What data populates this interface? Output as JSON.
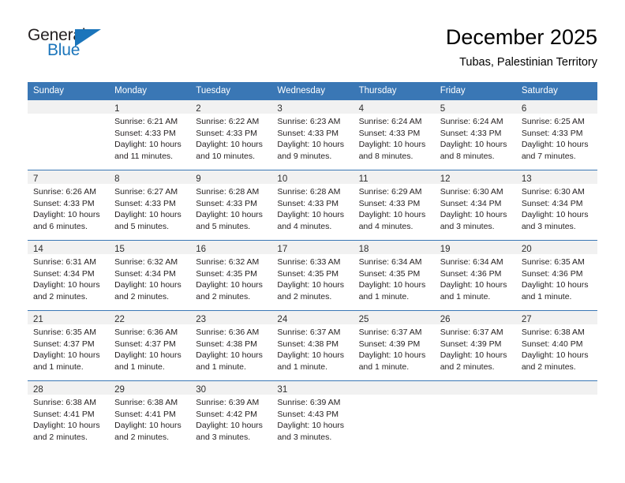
{
  "logo": {
    "word_top": "General",
    "word_bottom": "Blue",
    "triangle_color": "#1b75bb",
    "text_color": "#231f20"
  },
  "header": {
    "month_title": "December 2025",
    "location": "Tubas, Palestinian Territory"
  },
  "theme": {
    "header_blue": "#3a77b5",
    "daynum_band": "#f1f1f1",
    "text": "#231f20"
  },
  "calendar": {
    "weekday_headers": [
      "Sunday",
      "Monday",
      "Tuesday",
      "Wednesday",
      "Thursday",
      "Friday",
      "Saturday"
    ],
    "weeks": [
      [
        {
          "day": "",
          "sunrise": "",
          "sunset": "",
          "daylight": "",
          "empty": true
        },
        {
          "day": "1",
          "sunrise": "Sunrise: 6:21 AM",
          "sunset": "Sunset: 4:33 PM",
          "daylight": "Daylight: 10 hours and 11 minutes."
        },
        {
          "day": "2",
          "sunrise": "Sunrise: 6:22 AM",
          "sunset": "Sunset: 4:33 PM",
          "daylight": "Daylight: 10 hours and 10 minutes."
        },
        {
          "day": "3",
          "sunrise": "Sunrise: 6:23 AM",
          "sunset": "Sunset: 4:33 PM",
          "daylight": "Daylight: 10 hours and 9 minutes."
        },
        {
          "day": "4",
          "sunrise": "Sunrise: 6:24 AM",
          "sunset": "Sunset: 4:33 PM",
          "daylight": "Daylight: 10 hours and 8 minutes."
        },
        {
          "day": "5",
          "sunrise": "Sunrise: 6:24 AM",
          "sunset": "Sunset: 4:33 PM",
          "daylight": "Daylight: 10 hours and 8 minutes."
        },
        {
          "day": "6",
          "sunrise": "Sunrise: 6:25 AM",
          "sunset": "Sunset: 4:33 PM",
          "daylight": "Daylight: 10 hours and 7 minutes."
        }
      ],
      [
        {
          "day": "7",
          "sunrise": "Sunrise: 6:26 AM",
          "sunset": "Sunset: 4:33 PM",
          "daylight": "Daylight: 10 hours and 6 minutes."
        },
        {
          "day": "8",
          "sunrise": "Sunrise: 6:27 AM",
          "sunset": "Sunset: 4:33 PM",
          "daylight": "Daylight: 10 hours and 5 minutes."
        },
        {
          "day": "9",
          "sunrise": "Sunrise: 6:28 AM",
          "sunset": "Sunset: 4:33 PM",
          "daylight": "Daylight: 10 hours and 5 minutes."
        },
        {
          "day": "10",
          "sunrise": "Sunrise: 6:28 AM",
          "sunset": "Sunset: 4:33 PM",
          "daylight": "Daylight: 10 hours and 4 minutes."
        },
        {
          "day": "11",
          "sunrise": "Sunrise: 6:29 AM",
          "sunset": "Sunset: 4:33 PM",
          "daylight": "Daylight: 10 hours and 4 minutes."
        },
        {
          "day": "12",
          "sunrise": "Sunrise: 6:30 AM",
          "sunset": "Sunset: 4:34 PM",
          "daylight": "Daylight: 10 hours and 3 minutes."
        },
        {
          "day": "13",
          "sunrise": "Sunrise: 6:30 AM",
          "sunset": "Sunset: 4:34 PM",
          "daylight": "Daylight: 10 hours and 3 minutes."
        }
      ],
      [
        {
          "day": "14",
          "sunrise": "Sunrise: 6:31 AM",
          "sunset": "Sunset: 4:34 PM",
          "daylight": "Daylight: 10 hours and 2 minutes."
        },
        {
          "day": "15",
          "sunrise": "Sunrise: 6:32 AM",
          "sunset": "Sunset: 4:34 PM",
          "daylight": "Daylight: 10 hours and 2 minutes."
        },
        {
          "day": "16",
          "sunrise": "Sunrise: 6:32 AM",
          "sunset": "Sunset: 4:35 PM",
          "daylight": "Daylight: 10 hours and 2 minutes."
        },
        {
          "day": "17",
          "sunrise": "Sunrise: 6:33 AM",
          "sunset": "Sunset: 4:35 PM",
          "daylight": "Daylight: 10 hours and 2 minutes."
        },
        {
          "day": "18",
          "sunrise": "Sunrise: 6:34 AM",
          "sunset": "Sunset: 4:35 PM",
          "daylight": "Daylight: 10 hours and 1 minute."
        },
        {
          "day": "19",
          "sunrise": "Sunrise: 6:34 AM",
          "sunset": "Sunset: 4:36 PM",
          "daylight": "Daylight: 10 hours and 1 minute."
        },
        {
          "day": "20",
          "sunrise": "Sunrise: 6:35 AM",
          "sunset": "Sunset: 4:36 PM",
          "daylight": "Daylight: 10 hours and 1 minute."
        }
      ],
      [
        {
          "day": "21",
          "sunrise": "Sunrise: 6:35 AM",
          "sunset": "Sunset: 4:37 PM",
          "daylight": "Daylight: 10 hours and 1 minute."
        },
        {
          "day": "22",
          "sunrise": "Sunrise: 6:36 AM",
          "sunset": "Sunset: 4:37 PM",
          "daylight": "Daylight: 10 hours and 1 minute."
        },
        {
          "day": "23",
          "sunrise": "Sunrise: 6:36 AM",
          "sunset": "Sunset: 4:38 PM",
          "daylight": "Daylight: 10 hours and 1 minute."
        },
        {
          "day": "24",
          "sunrise": "Sunrise: 6:37 AM",
          "sunset": "Sunset: 4:38 PM",
          "daylight": "Daylight: 10 hours and 1 minute."
        },
        {
          "day": "25",
          "sunrise": "Sunrise: 6:37 AM",
          "sunset": "Sunset: 4:39 PM",
          "daylight": "Daylight: 10 hours and 1 minute."
        },
        {
          "day": "26",
          "sunrise": "Sunrise: 6:37 AM",
          "sunset": "Sunset: 4:39 PM",
          "daylight": "Daylight: 10 hours and 2 minutes."
        },
        {
          "day": "27",
          "sunrise": "Sunrise: 6:38 AM",
          "sunset": "Sunset: 4:40 PM",
          "daylight": "Daylight: 10 hours and 2 minutes."
        }
      ],
      [
        {
          "day": "28",
          "sunrise": "Sunrise: 6:38 AM",
          "sunset": "Sunset: 4:41 PM",
          "daylight": "Daylight: 10 hours and 2 minutes."
        },
        {
          "day": "29",
          "sunrise": "Sunrise: 6:38 AM",
          "sunset": "Sunset: 4:41 PM",
          "daylight": "Daylight: 10 hours and 2 minutes."
        },
        {
          "day": "30",
          "sunrise": "Sunrise: 6:39 AM",
          "sunset": "Sunset: 4:42 PM",
          "daylight": "Daylight: 10 hours and 3 minutes."
        },
        {
          "day": "31",
          "sunrise": "Sunrise: 6:39 AM",
          "sunset": "Sunset: 4:43 PM",
          "daylight": "Daylight: 10 hours and 3 minutes."
        },
        {
          "day": "",
          "sunrise": "",
          "sunset": "",
          "daylight": "",
          "empty": true
        },
        {
          "day": "",
          "sunrise": "",
          "sunset": "",
          "daylight": "",
          "empty": true
        },
        {
          "day": "",
          "sunrise": "",
          "sunset": "",
          "daylight": "",
          "empty": true
        }
      ]
    ]
  }
}
